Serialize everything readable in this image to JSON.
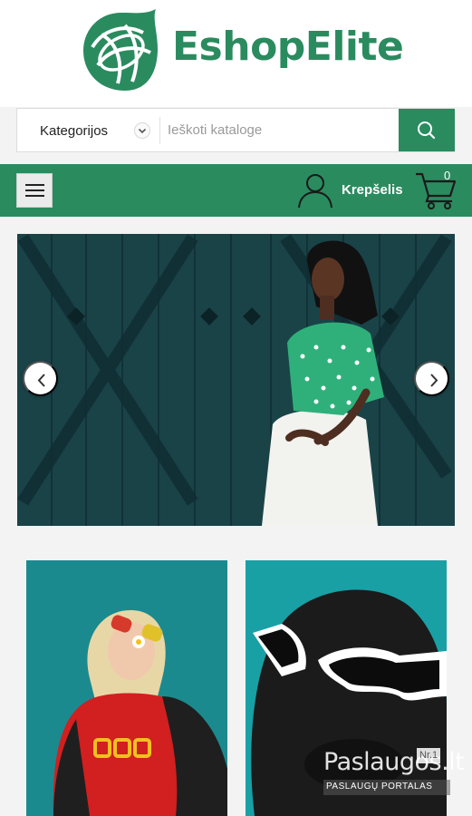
{
  "brand": {
    "name": "EshopElite",
    "color": "#2a8b5f"
  },
  "search": {
    "category_label": "Kategorijos",
    "placeholder": "Ieškoti kataloge",
    "button_icon": "search-icon"
  },
  "nav": {
    "menu_icon": "hamburger-icon",
    "account_icon": "user-icon",
    "cart_label": "Krepšelis",
    "cart_count": "0",
    "cart_icon": "cart-icon"
  },
  "slider": {
    "prev_icon": "chevron-left-icon",
    "next_icon": "chevron-right-icon"
  },
  "watermark": {
    "title": "Paslaugos.lt",
    "subtitle": "PASLAUGŲ PORTALAS",
    "badge": "Nr.1"
  }
}
